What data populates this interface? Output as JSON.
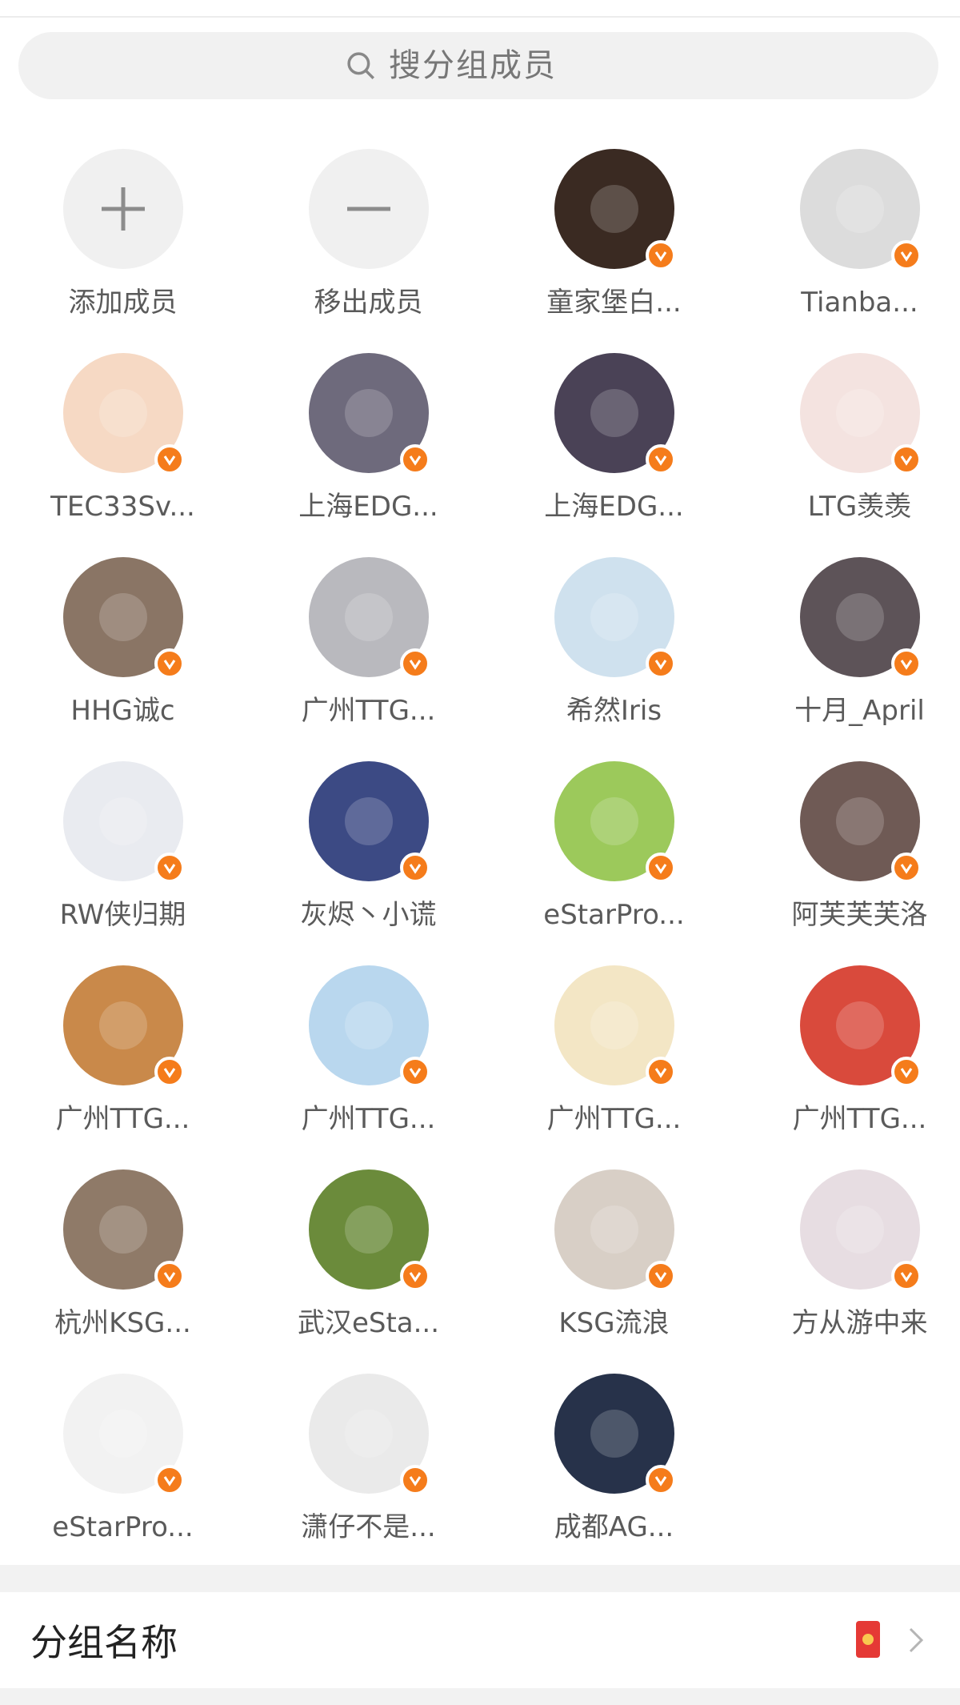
{
  "search": {
    "placeholder": "搜分组成员"
  },
  "actions": [
    {
      "label": "添加成员",
      "icon": "plus-icon"
    },
    {
      "label": "移出成员",
      "icon": "minus-icon"
    }
  ],
  "members": [
    {
      "name": "童家堡白...",
      "color": "#3a2a22",
      "verified": true
    },
    {
      "name": "Tianba...",
      "color": "#dcdcdc",
      "verified": true
    },
    {
      "name": "TEC33Sv...",
      "color": "#f6d9c4",
      "verified": true
    },
    {
      "name": "上海EDG...",
      "color": "#6e6a7c",
      "verified": true
    },
    {
      "name": "上海EDG...",
      "color": "#4a4256",
      "verified": true
    },
    {
      "name": "LTG羡羡",
      "color": "#f4e3e0",
      "verified": true
    },
    {
      "name": "HHG诚c",
      "color": "#8a7565",
      "verified": true
    },
    {
      "name": "广州TTG...",
      "color": "#b9b9be",
      "verified": true
    },
    {
      "name": "希然Iris",
      "color": "#cfe1ee",
      "verified": true
    },
    {
      "name": "十月_April",
      "color": "#5d5358",
      "verified": true
    },
    {
      "name": "RW侠归期",
      "color": "#e9ebf0",
      "verified": true
    },
    {
      "name": "灰烬丶小谎",
      "color": "#3c4a84",
      "verified": true
    },
    {
      "name": "eStarPro...",
      "color": "#9cc95b",
      "verified": true
    },
    {
      "name": "阿芙芙芙洛",
      "color": "#6f5a55",
      "verified": true
    },
    {
      "name": "广州TTG...",
      "color": "#c9894a",
      "verified": true
    },
    {
      "name": "广州TTG...",
      "color": "#b9d7ee",
      "verified": true
    },
    {
      "name": "广州TTG...",
      "color": "#f3e6c5",
      "verified": true
    },
    {
      "name": "广州TTG...",
      "color": "#d94a3c",
      "verified": true
    },
    {
      "name": "杭州KSG...",
      "color": "#8f7a68",
      "verified": true
    },
    {
      "name": "武汉eSta...",
      "color": "#6b8b3b",
      "verified": true
    },
    {
      "name": "KSG流浪",
      "color": "#d8cfc6",
      "verified": true
    },
    {
      "name": "方从游中来",
      "color": "#e7dde2",
      "verified": true
    },
    {
      "name": "eStarPro...",
      "color": "#f2f2f2",
      "verified": true
    },
    {
      "name": "潇仔不是...",
      "color": "#eaeaea",
      "verified": true
    },
    {
      "name": "成都AG...",
      "color": "#27324a",
      "verified": true
    }
  ],
  "group": {
    "label": "分组名称"
  },
  "colors": {
    "badge": "#f57c1b",
    "accent": "#e53935"
  }
}
